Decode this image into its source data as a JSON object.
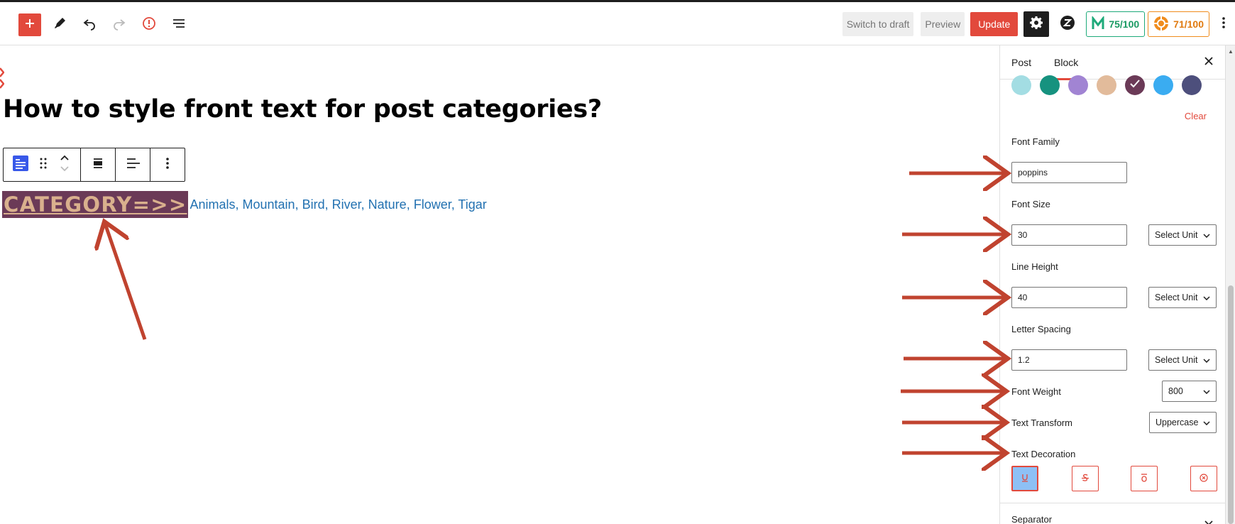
{
  "toolbar": {
    "add_icon": "plus-icon",
    "tools_icon": "pencil-icon",
    "undo_icon": "undo-icon",
    "redo_icon": "redo-icon",
    "details_icon": "info-icon",
    "list_view_icon": "list-view-icon",
    "switch_draft_label": "Switch to draft",
    "preview_label": "Preview",
    "update_label": "Update",
    "settings_icon": "gear-icon",
    "plugin_icon": "zigzag-icon",
    "score_green": "75/100",
    "score_orange": "71/100",
    "more_icon": "more-vertical-icon"
  },
  "editor": {
    "post_title": "How to style front text for post categories?",
    "category_label": "CATEGORY=>>",
    "categories": [
      "Animals",
      "Mountain",
      "Bird",
      "River",
      "Nature",
      "Flower",
      "Tigar"
    ],
    "separator": ", "
  },
  "sidebar": {
    "tabs": [
      "Post",
      "Block"
    ],
    "active_tab": "Block",
    "close_icon": "close-icon",
    "swatch_colors": [
      "#a3dde3",
      "#16927f",
      "#a184d3",
      "#e2bb9b",
      "#6b3a57",
      "#3aacf1",
      "#4d4f7c"
    ],
    "selected_swatch_index": 4,
    "clear_label": "Clear",
    "font_family_label": "Font Family",
    "font_family_value": "poppins",
    "font_size_label": "Font Size",
    "font_size_value": "30",
    "line_height_label": "Line Height",
    "line_height_value": "40",
    "letter_spacing_label": "Letter Spacing",
    "letter_spacing_value": "1.2",
    "unit_placeholder": "Select Unit",
    "font_weight_label": "Font Weight",
    "font_weight_value": "800",
    "text_transform_label": "Text Transform",
    "text_transform_value": "Uppercase",
    "text_decoration_label": "Text Decoration",
    "decoration_options": [
      "underline",
      "line-through",
      "overline",
      "none"
    ],
    "separator_label": "Separator"
  },
  "colors": {
    "accent": "#e2493c",
    "link": "#2271b1",
    "category_bg": "#6b3a57",
    "category_text": "#d9b08d",
    "annotation_arrow": "#c0432f"
  }
}
